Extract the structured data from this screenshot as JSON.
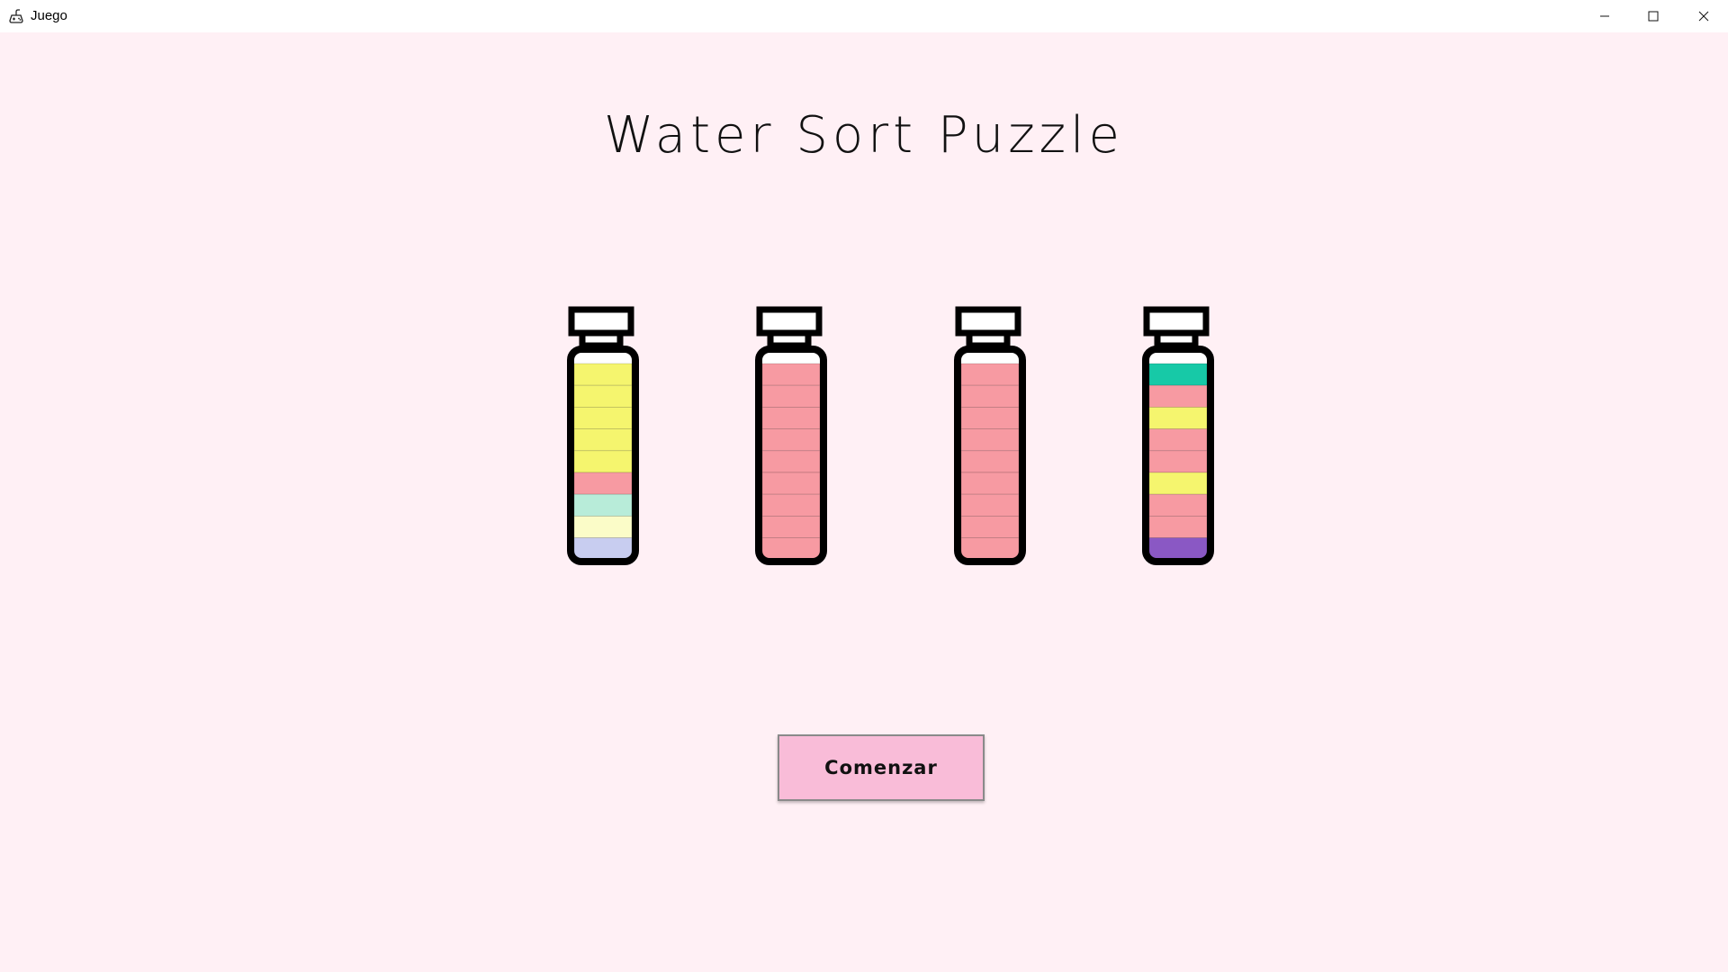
{
  "window": {
    "title": "Juego",
    "icon": "game-controller-icon",
    "controls": [
      "minimize-icon",
      "maximize-icon",
      "close-icon"
    ]
  },
  "game": {
    "title": "Water Sort Puzzle",
    "start_label": "Comenzar"
  },
  "colors": {
    "background": "#fff0f5",
    "button": "#f9bcd8",
    "yellow": "#f5f56e",
    "pink": "#f79aa2",
    "mint": "#b8ecd9",
    "cream": "#fbfcc8",
    "lavender": "#c8cdf0",
    "teal": "#17c9a7",
    "purple": "#8a58c4"
  },
  "bottles": [
    {
      "layers": [
        "yellow",
        "yellow",
        "yellow",
        "yellow",
        "yellow",
        "pink",
        "mint",
        "cream",
        "lavender"
      ]
    },
    {
      "layers": [
        "pink",
        "pink",
        "pink",
        "pink",
        "pink",
        "pink",
        "pink",
        "pink",
        "pink"
      ]
    },
    {
      "layers": [
        "pink",
        "pink",
        "pink",
        "pink",
        "pink",
        "pink",
        "pink",
        "pink",
        "pink"
      ]
    },
    {
      "layers": [
        "teal",
        "pink",
        "yellow",
        "pink",
        "pink",
        "yellow",
        "pink",
        "pink",
        "purple"
      ]
    }
  ]
}
